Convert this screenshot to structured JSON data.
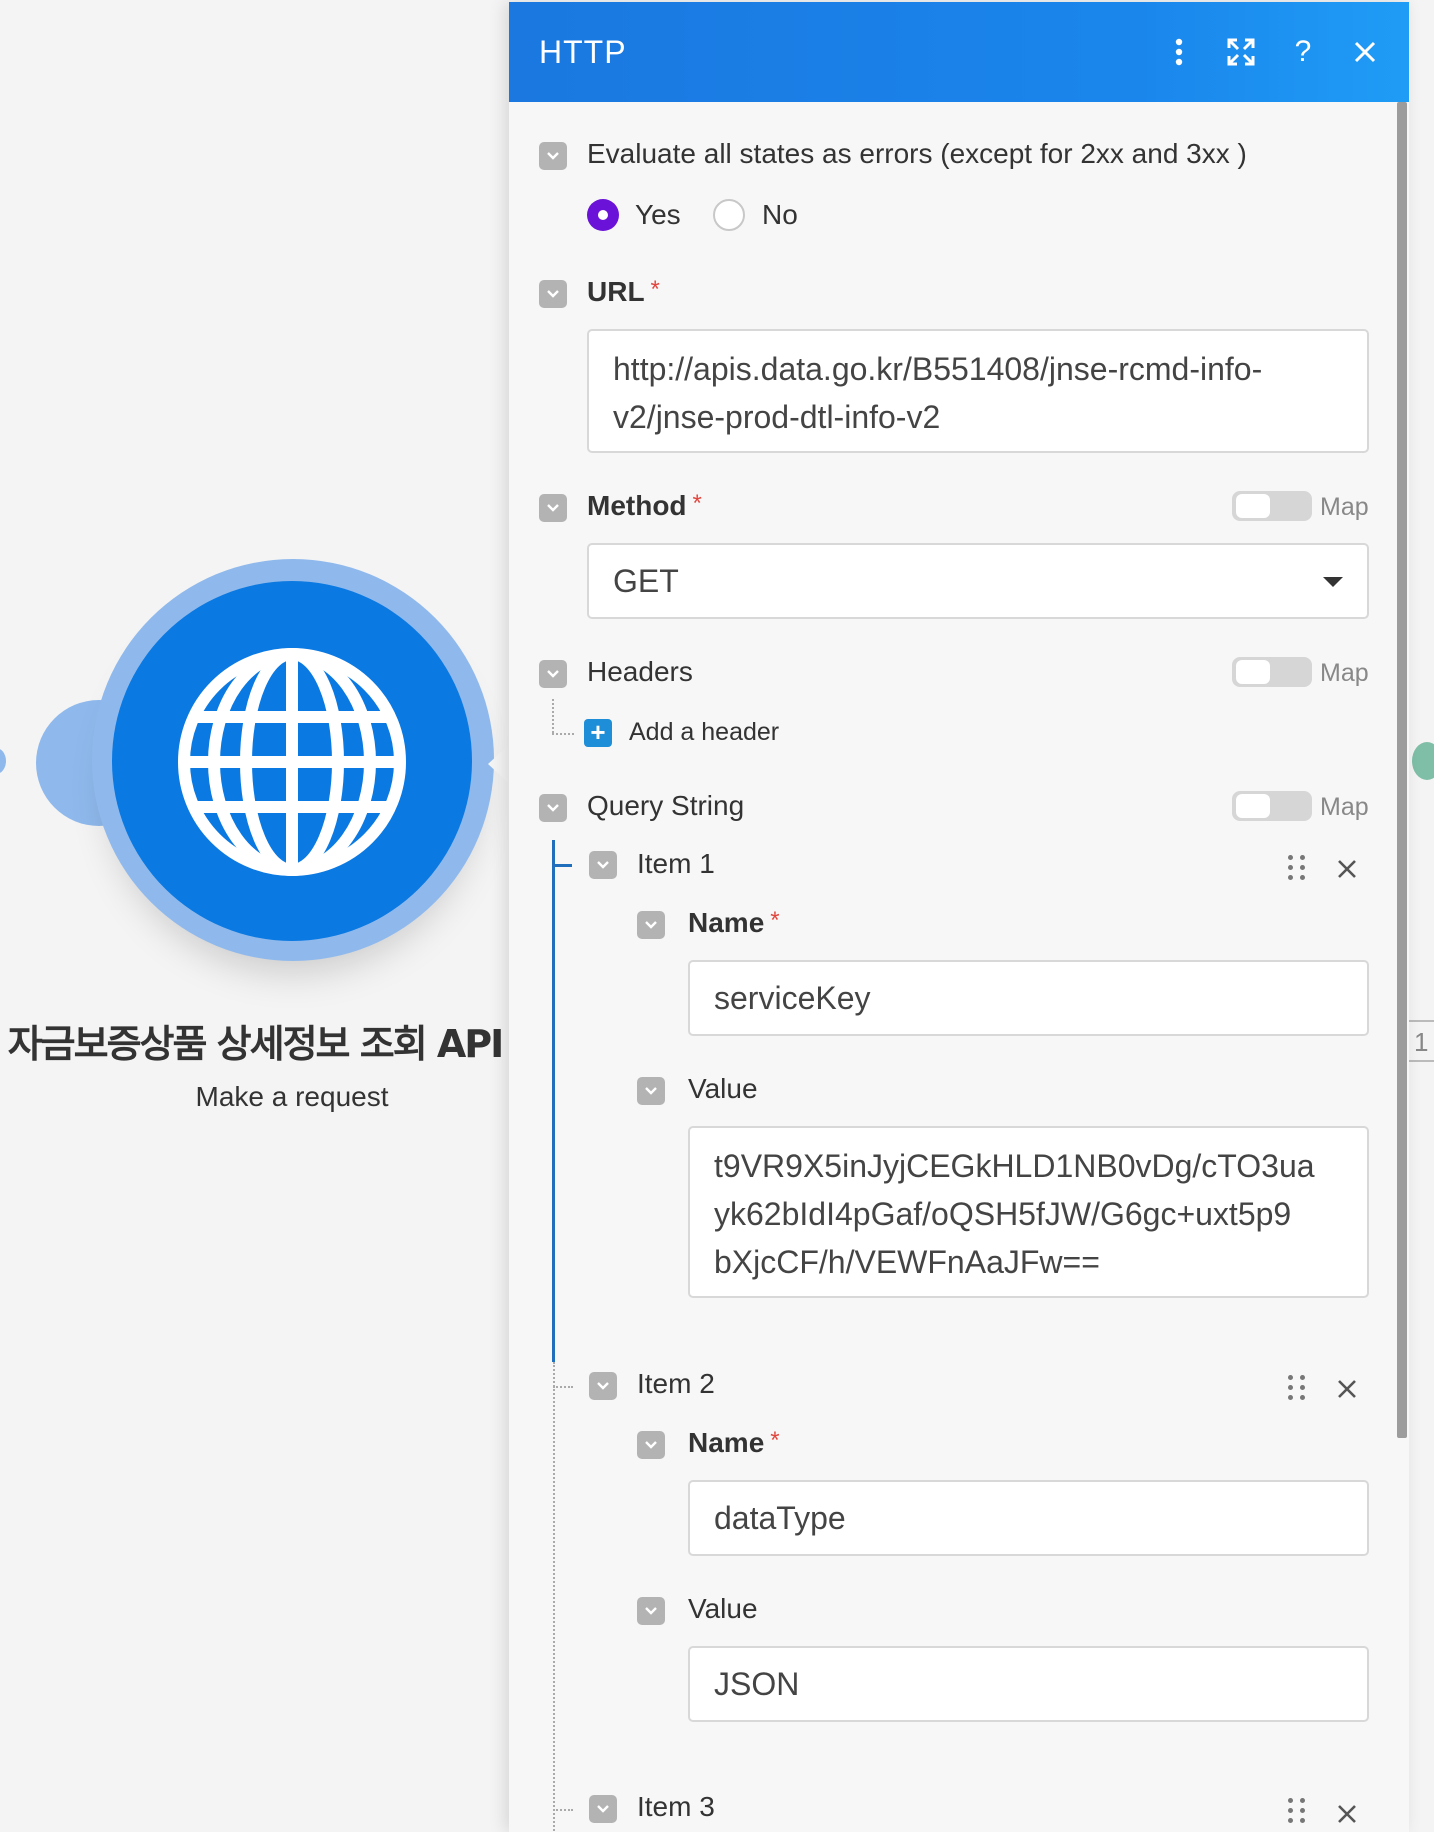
{
  "module": {
    "name": "자금보증상품 상세정보 조회 API",
    "subtitle": "Make a request",
    "right_tab": "1"
  },
  "panel": {
    "title": "HTTP",
    "icons": [
      "more-vertical-icon",
      "expand-icon",
      "help-icon",
      "close-icon"
    ],
    "evaluate": {
      "label": "Evaluate all states as errors (except for 2xx and 3xx )",
      "options": [
        "Yes",
        "No"
      ],
      "selected": "Yes"
    },
    "url": {
      "label": "URL",
      "required": "*",
      "value_line1": "http://apis.data.go.kr/B551408/jnse-rcmd-info-",
      "value_line2": "v2/jnse-prod-dtl-info-v2"
    },
    "method": {
      "label": "Method",
      "required": "*",
      "map_label": "Map",
      "value": "GET"
    },
    "headers": {
      "label": "Headers",
      "map_label": "Map",
      "add_label": "Add a header"
    },
    "query_string": {
      "label": "Query String",
      "map_label": "Map",
      "items": [
        {
          "title": "Item 1",
          "name_label": "Name",
          "required": "*",
          "name_value": "serviceKey",
          "value_label": "Value",
          "value_line1": "t9VR9X5inJyjCEGkHLD1NB0vDg/cTO3ua",
          "value_line2": "yk62bIdI4pGaf/oQSH5fJW/G6gc+uxt5p9",
          "value_line3": "bXjcCF/h/VEWFnAaJFw=="
        },
        {
          "title": "Item 2",
          "name_label": "Name",
          "required": "*",
          "name_value": "dataType",
          "value_label": "Value",
          "value": "JSON"
        },
        {
          "title": "Item 3"
        }
      ]
    }
  },
  "colors": {
    "header_blue": "#1a78e0",
    "module_blue": "#0a79e2",
    "module_halo": "#8fb9ec",
    "radio_selected": "#6b12d8",
    "required_red": "#e0473f"
  }
}
